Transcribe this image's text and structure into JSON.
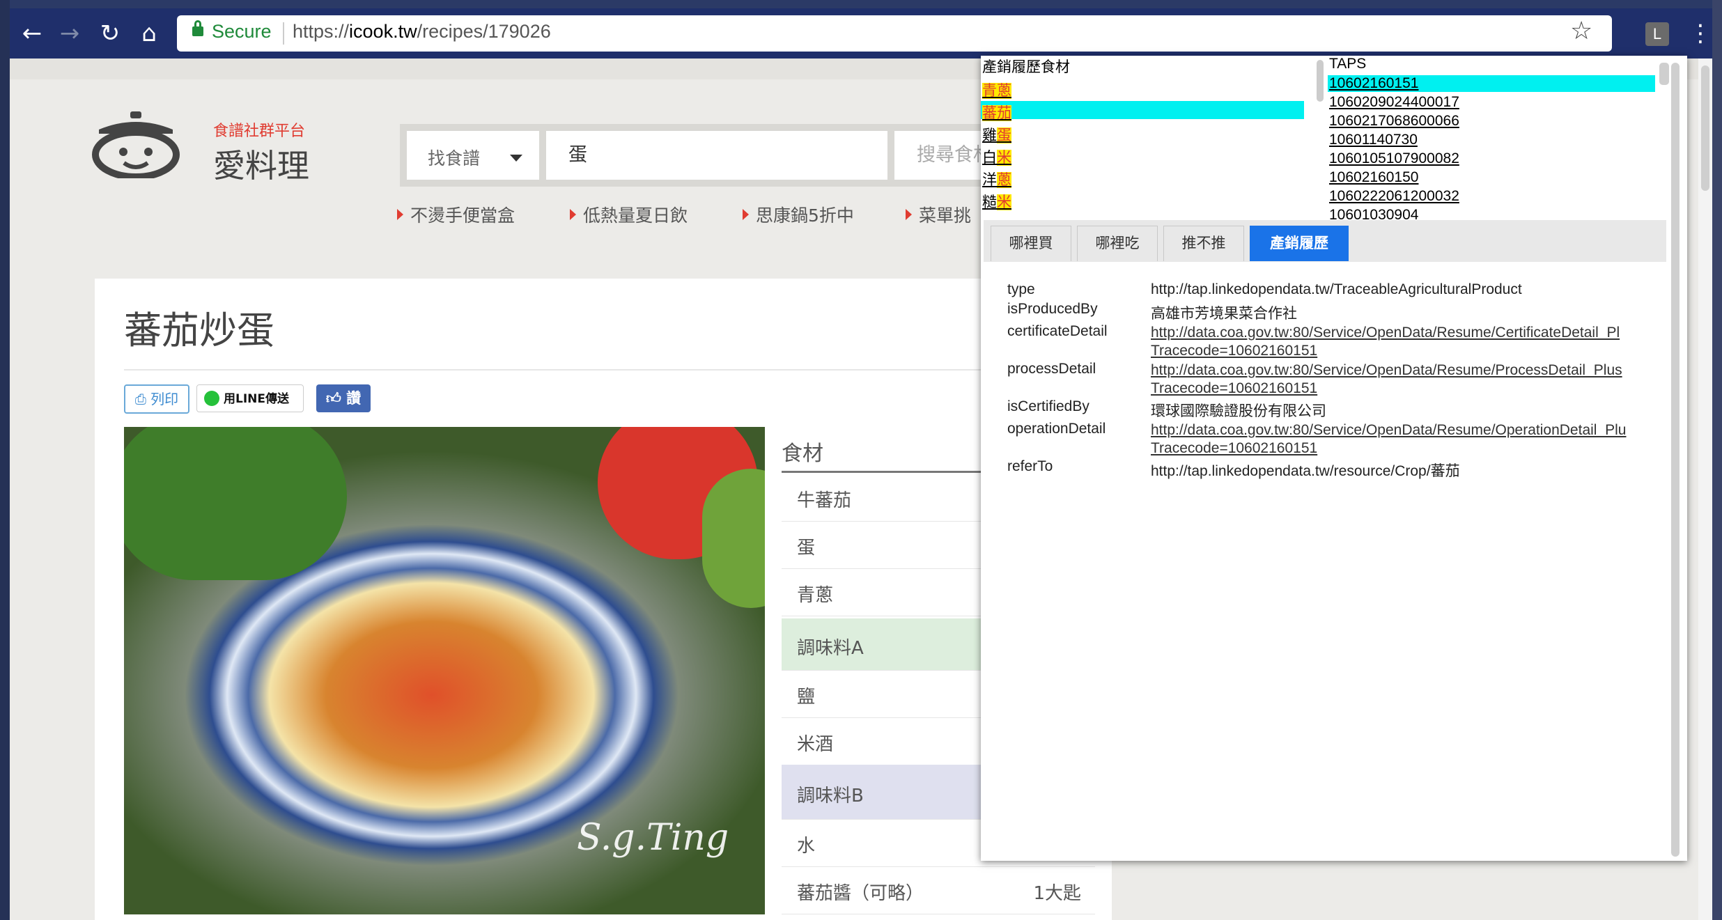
{
  "browser": {
    "secure_label": "Secure",
    "url_scheme": "https://",
    "url_domain": "icook.tw",
    "url_path": "/recipes/179026",
    "extension_label": "L"
  },
  "site": {
    "tagline": "食譜社群平台",
    "name": "愛料理",
    "search_type": "找食譜",
    "search_value": "蛋",
    "search_placeholder": "搜尋食材",
    "promos": [
      "不燙手便當盒",
      "低熱量夏日飲",
      "思康鍋5折中",
      "菜單挑"
    ]
  },
  "recipe": {
    "title": "蕃茄炒蛋",
    "print_label": "列印",
    "line_label": "用LINE傳送",
    "like_label": "讚",
    "photo_signature": "S.g.Ting",
    "ingredients_header": "食材",
    "ingredients": [
      {
        "name": "牛蕃茄",
        "qty": ""
      },
      {
        "name": "蛋",
        "qty": ""
      },
      {
        "name": "青蔥",
        "qty": ""
      },
      {
        "name": "調味料A",
        "qty": "",
        "group": true
      },
      {
        "name": "鹽",
        "qty": ""
      },
      {
        "name": "米酒",
        "qty": ""
      },
      {
        "name": "調味料B",
        "qty": "",
        "group": true
      },
      {
        "name": "水",
        "qty": ""
      },
      {
        "name": "蕃茄醬（可略）",
        "qty": "1大匙"
      }
    ]
  },
  "popup": {
    "food_header": "產銷履歷食材",
    "foods": [
      {
        "prefix": "",
        "hl": "青蔥"
      },
      {
        "prefix": "",
        "hl": "蕃茄"
      },
      {
        "prefix": "雞",
        "hl": "蛋"
      },
      {
        "prefix": "白",
        "hl": "米"
      },
      {
        "prefix": "洋",
        "hl": "蔥"
      },
      {
        "prefix": "糙",
        "hl": "米"
      }
    ],
    "taps_header": "TAPS",
    "taps": [
      "10602160151",
      "1060209024400017",
      "1060217068600066",
      "10601140730",
      "1060105107900082",
      "10602160150",
      "1060222061200032",
      "10601030904"
    ],
    "tabs": [
      "哪裡買",
      "哪裡吃",
      "推不推",
      "產銷履歷"
    ],
    "active_tab": "產銷履歷",
    "props": [
      {
        "key": "type",
        "value": "http://tap.linkedopendata.tw/TraceableAgriculturalProduct"
      },
      {
        "key": "isProducedBy",
        "value": "高雄市芳境果菜合作社"
      },
      {
        "key": "certificateDetail",
        "value": "http://data.coa.gov.tw:80/Service/OpenData/Resume/CertificateDetail_Pl",
        "value2": "Tracecode=10602160151"
      },
      {
        "key": "processDetail",
        "value": "http://data.coa.gov.tw:80/Service/OpenData/Resume/ProcessDetail_Plus",
        "value2": "Tracecode=10602160151"
      },
      {
        "key": "isCertifiedBy",
        "value": "環球國際驗證股份有限公司"
      },
      {
        "key": "operationDetail",
        "value": "http://data.coa.gov.tw:80/Service/OpenData/Resume/OperationDetail_Plu",
        "value2": "Tracecode=10602160151"
      },
      {
        "key": "referTo",
        "value": "http://tap.linkedopendata.tw/resource/Crop/蕃茄"
      }
    ]
  }
}
